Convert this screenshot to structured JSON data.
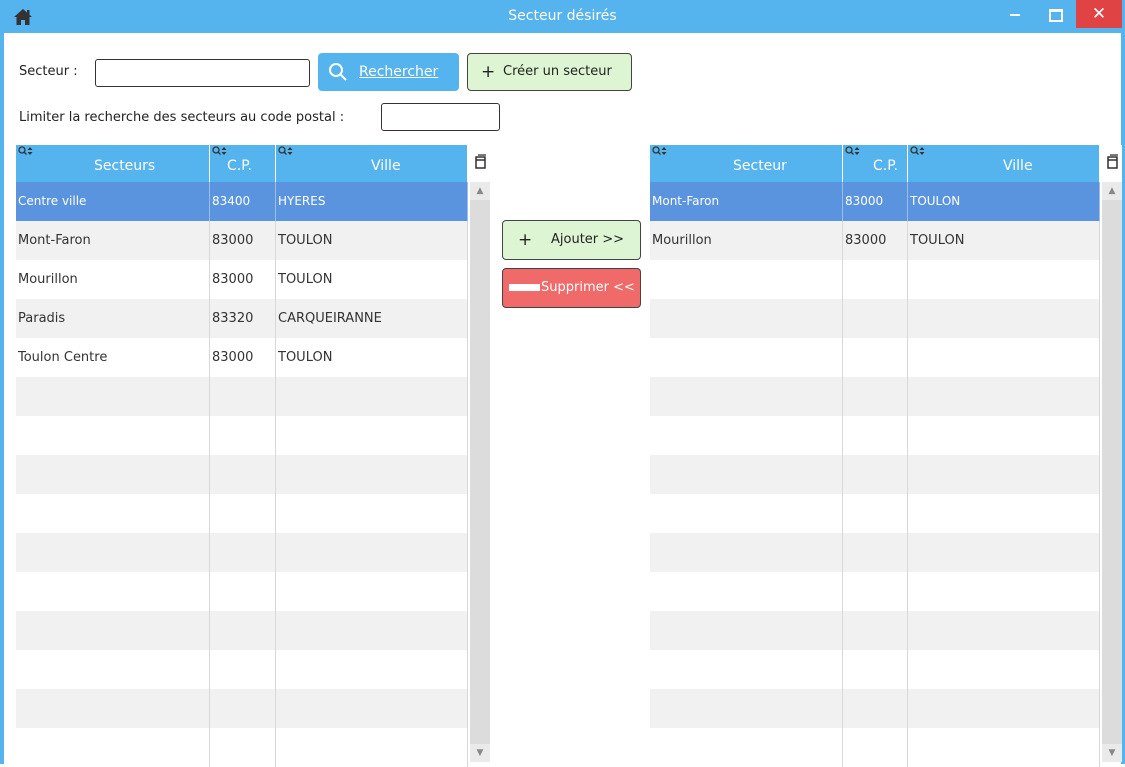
{
  "window": {
    "title": "Secteur désirés",
    "close_glyph": "✕"
  },
  "search": {
    "label": "Secteur :",
    "value": "",
    "button_label": "Rechercher",
    "create_label": "Créer un secteur"
  },
  "postal_filter": {
    "label": "Limiter la recherche des secteurs au code postal :",
    "value": ""
  },
  "left_table": {
    "headers": [
      "Secteurs",
      "C.P.",
      "Ville"
    ],
    "rows": [
      [
        "Centre ville",
        "83400",
        "HYERES"
      ],
      [
        "Mont-Faron",
        "83000",
        "TOULON"
      ],
      [
        "Mourillon",
        "83000",
        "TOULON"
      ],
      [
        "Paradis",
        "83320",
        "CARQUEIRANNE"
      ],
      [
        "Toulon Centre",
        "83000",
        "TOULON"
      ]
    ],
    "selected_row": 0
  },
  "right_table": {
    "headers": [
      "Secteur",
      "C.P.",
      "Ville"
    ],
    "rows": [
      [
        "Mont-Faron",
        "83000",
        "TOULON"
      ],
      [
        "Mourillon",
        "83000",
        "TOULON"
      ]
    ],
    "selected_row": 0
  },
  "actions": {
    "add_label": "Ajouter >>",
    "remove_label": "Supprimer <<"
  },
  "colors": {
    "title_bar": "#55b3ee",
    "selected_row": "#5b94de",
    "add_button": "#ddf5d2",
    "remove_button": "#f06a6a",
    "close_button": "#e04343"
  },
  "icons": [
    "home-icon",
    "minimize-icon",
    "maximize-icon",
    "close-icon",
    "search-icon",
    "plus-icon",
    "minus-icon",
    "sort-search-icon",
    "column-chooser-icon"
  ]
}
